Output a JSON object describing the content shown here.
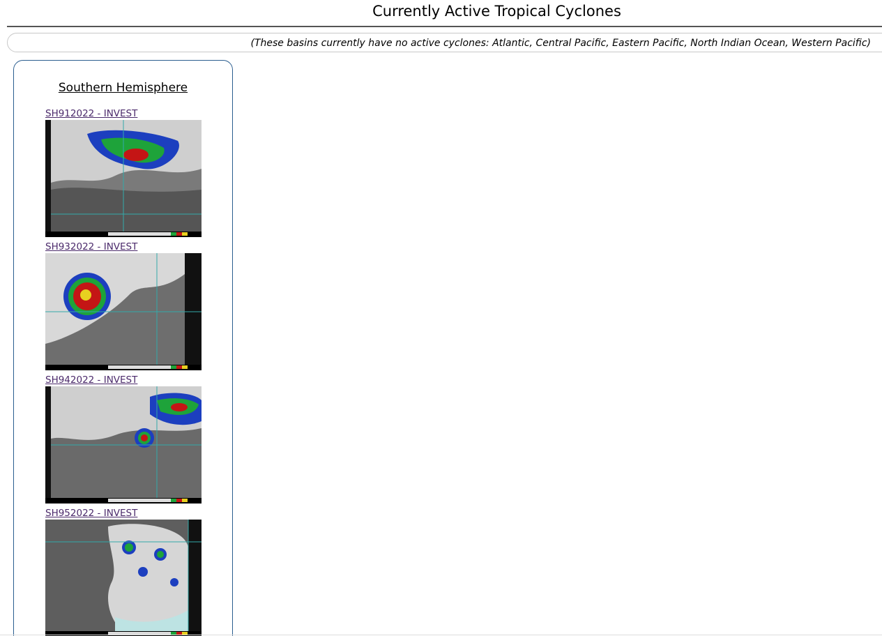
{
  "page": {
    "title": "Currently Active Tropical Cyclones",
    "inactive_note": "(These basins currently have no active cyclones: Atlantic, Central Pacific, Eastern Pacific, North Indian Ocean, Western Pacific)"
  },
  "basin": {
    "heading": "Southern Hemisphere",
    "storms": [
      {
        "label": "SH912022 - INVEST",
        "image_icon": "satellite-image-icon"
      },
      {
        "label": "SH932022 - INVEST",
        "image_icon": "satellite-image-icon"
      },
      {
        "label": "SH942022 - INVEST",
        "image_icon": "satellite-image-icon"
      },
      {
        "label": "SH952022 - INVEST",
        "image_icon": "satellite-image-icon"
      }
    ]
  },
  "colors": {
    "panel_border": "#2a5d8f",
    "link": "#4b2a6b",
    "rule": "#555555"
  }
}
